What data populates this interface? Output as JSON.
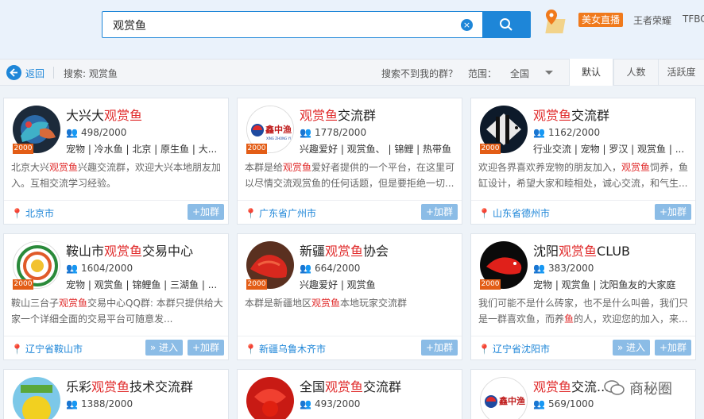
{
  "search": {
    "query": "观赏鱼"
  },
  "top_links": {
    "live": "美女直播",
    "game": "王者荣耀",
    "tfbc": "TFBC"
  },
  "filterbar": {
    "back": "返回",
    "search_label": "搜索: 观赏鱼",
    "cannot_find": "搜索不到我的群？",
    "range_label": "范围：",
    "range_value": "全国",
    "tabs": [
      "默认",
      "人数",
      "活跃度"
    ]
  },
  "cards": [
    {
      "title_pre": "大兴大",
      "title_hl": "观赏鱼",
      "title_post": "",
      "count": "498/2000",
      "tags": "宠物 | 冷水鱼 | 北京 | 原生鱼 | 大...",
      "desc_pre": "北京大兴",
      "desc_hl": "观赏鱼",
      "desc_post": "兴趣交流群，欢迎大兴本地朋友加入。互相交流学习经验。",
      "location": "北京市",
      "join": "+加群",
      "enter": ""
    },
    {
      "title_pre": "",
      "title_hl": "观赏鱼",
      "title_post": "交流群",
      "count": "1778/2000",
      "tags": "兴趣爱好 | 观赏鱼、 | 锦鲤 | 热带鱼",
      "desc_pre": "本群是给",
      "desc_hl": "观赏鱼",
      "desc_post": "爱好者提供的一个平台，在这里可以尽情交流观赏鱼的任何话题，但是要拒绝一切...",
      "location": "广东省广州市",
      "join": "+加群",
      "enter": ""
    },
    {
      "title_pre": "",
      "title_hl": "观赏鱼",
      "title_post": "交流群",
      "count": "1162/2000",
      "tags": "行业交流 | 宠物 | 罗汉 | 观赏鱼 | ...",
      "desc_pre": "欢迎各界喜欢养宠物的朋友加入，",
      "desc_hl": "观赏鱼",
      "desc_post": "饲养，鱼缸设计，希望大家和睦相处，诚心交流，和气生...",
      "location": "山东省德州市",
      "join": "+加群",
      "enter": ""
    },
    {
      "title_pre": "鞍山市",
      "title_hl": "观赏鱼",
      "title_post": "交易中心",
      "count": "1604/2000",
      "tags": "宠物 | 观赏鱼 | 锦鲤鱼 | 三湖鱼 | ...",
      "desc_pre": "鞍山三台子",
      "desc_hl": "观赏鱼",
      "desc_post": "交易中心QQ群:          本群只提供给大家一个详细全面的交易平台可随意发...",
      "location": "辽宁省鞍山市",
      "join": "+加群",
      "enter": "» 进入"
    },
    {
      "title_pre": "新疆",
      "title_hl": "观赏鱼",
      "title_post": "协会",
      "count": "664/2000",
      "tags": "兴趣爱好 | 观赏鱼",
      "desc_pre": "本群是新疆地区",
      "desc_hl": "观赏鱼",
      "desc_post": "本地玩家交流群",
      "location": "新疆乌鲁木齐市",
      "join": "+加群",
      "enter": ""
    },
    {
      "title_pre": "沈阳",
      "title_hl": "观赏鱼",
      "title_post": "CLUB",
      "count": "383/2000",
      "tags": "宠物 | 观赏鱼 | 沈阳鱼友的大家庭",
      "desc_pre": "我们可能不是什么砖家，也不是什么叫兽，我们只是一群喜欢鱼，而养",
      "desc_hl": "鱼",
      "desc_post": "的人，欢迎您的加入，来...",
      "location": "辽宁省沈阳市",
      "join": "+加群",
      "enter": "» 进入"
    },
    {
      "title_pre": "乐彩",
      "title_hl": "观赏鱼",
      "title_post": "技术交流群",
      "count": "1388/2000",
      "tags": "",
      "desc_pre": "",
      "desc_hl": "",
      "desc_post": "",
      "location": "",
      "join": "",
      "enter": ""
    },
    {
      "title_pre": "全国",
      "title_hl": "观赏鱼",
      "title_post": "交流群",
      "count": "493/2000",
      "tags": "",
      "desc_pre": "",
      "desc_hl": "",
      "desc_post": "",
      "location": "",
      "join": "",
      "enter": ""
    },
    {
      "title_pre": "",
      "title_hl": "观赏鱼",
      "title_post": "交流...",
      "count": "569/1000",
      "tags": "",
      "desc_pre": "",
      "desc_hl": "",
      "desc_post": "",
      "location": "",
      "join": "",
      "enter": ""
    }
  ],
  "badge_2000": "2000",
  "logo_text": "鑫中渔",
  "watermark": "商秘圈"
}
